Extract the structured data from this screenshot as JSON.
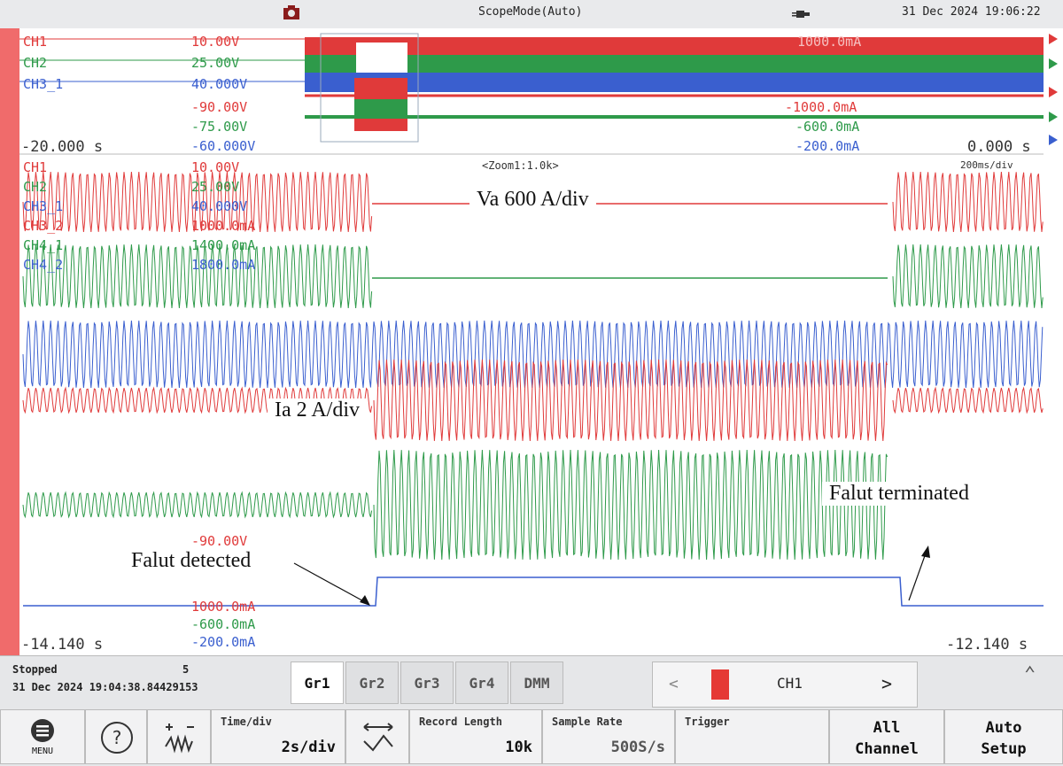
{
  "topbar": {
    "mode": "ScopeMode(Auto)",
    "datetime": "31 Dec 2024 19:06:22"
  },
  "overview": {
    "channels": [
      {
        "name": "CH1",
        "scale": "10.00V",
        "color": "#e03a3a"
      },
      {
        "name": "CH2",
        "scale": "25.00V",
        "color": "#2e9a4a"
      },
      {
        "name": "CH3_1",
        "scale": "40.000V",
        "color": "#3a5fcf"
      }
    ],
    "neg_scales": [
      {
        "v": "-90.00V",
        "a": "-1000.0mA"
      },
      {
        "v": "-75.00V",
        "a": "-600.0mA"
      },
      {
        "v": "-60.000V",
        "a": "-200.0mA"
      }
    ],
    "right_scale": "1000.0mA",
    "time_start": "-20.000 s",
    "time_end": "0.000 s"
  },
  "zoom": {
    "title": "<Zoom1:1.0k>",
    "timediv": "200ms/div",
    "channels": [
      {
        "name": "CH1",
        "scale": "10.00V"
      },
      {
        "name": "CH2",
        "scale": "25.00V"
      },
      {
        "name": "CH3_1",
        "scale": "40.000V"
      },
      {
        "name": "CH3_2",
        "scale": "1000.0mA"
      },
      {
        "name": "CH4_1",
        "scale": "1400.0mA"
      },
      {
        "name": "CH4_2",
        "scale": "1800.0mA"
      }
    ],
    "bottom_scales": [
      "-90.00V",
      "1000.0mA",
      "-600.0mA",
      "-200.0mA"
    ],
    "time_start": "-14.140 s",
    "time_end": "-12.140 s"
  },
  "annotations": {
    "va": "Va 600 A/div",
    "ia": "Ia 2 A/div",
    "detected": "Falut detected",
    "terminated": "Falut terminated"
  },
  "status": {
    "state": "Stopped",
    "count": "5",
    "timestamp": "31 Dec 2024 19:04:38.84429153"
  },
  "groups": [
    "Gr1",
    "Gr2",
    "Gr3",
    "Gr4",
    "DMM"
  ],
  "channel_selector": {
    "name": "CH1",
    "prev": "<",
    "next": ">"
  },
  "buttons": {
    "menu": "MENU",
    "timediv_label": "Time/div",
    "timediv_value": "2s/div",
    "record_label": "Record Length",
    "record_value": "10k",
    "sample_label": "Sample Rate",
    "sample_value": "500S/s",
    "trigger_label": "Trigger",
    "all_channel_1": "All",
    "all_channel_2": "Channel",
    "auto_setup_1": "Auto",
    "auto_setup_2": "Setup"
  },
  "colors": {
    "ch1": "#e03a3a",
    "ch2": "#2e9a4a",
    "ch3": "#3a5fcf",
    "sidebar": "#f06b6b"
  }
}
